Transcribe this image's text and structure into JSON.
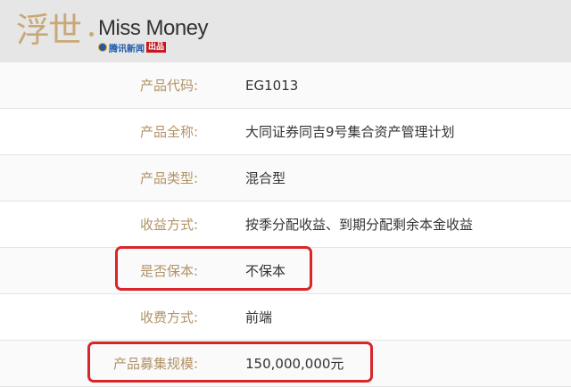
{
  "header": {
    "logo_cn": "浮世",
    "logo_en": "Miss Money",
    "logo_sub": "腾讯新闻",
    "logo_badge": "出品",
    "bg_color": "#e6e6e6",
    "accent_color": "#c9a877"
  },
  "table": {
    "label_color": "#b29265",
    "highlight_color": "#d8262a",
    "rows": [
      {
        "label": "产品代码:",
        "value": "EG1013"
      },
      {
        "label": "产品全称:",
        "value": "大同证券同吉9号集合资产管理计划"
      },
      {
        "label": "产品类型:",
        "value": "混合型"
      },
      {
        "label": "收益方式:",
        "value": "按季分配收益、到期分配剩余本金收益"
      },
      {
        "label": "是否保本:",
        "value": "不保本"
      },
      {
        "label": "收费方式:",
        "value": "前端"
      },
      {
        "label": "产品募集规模:",
        "value": "150,000,000元"
      }
    ]
  }
}
